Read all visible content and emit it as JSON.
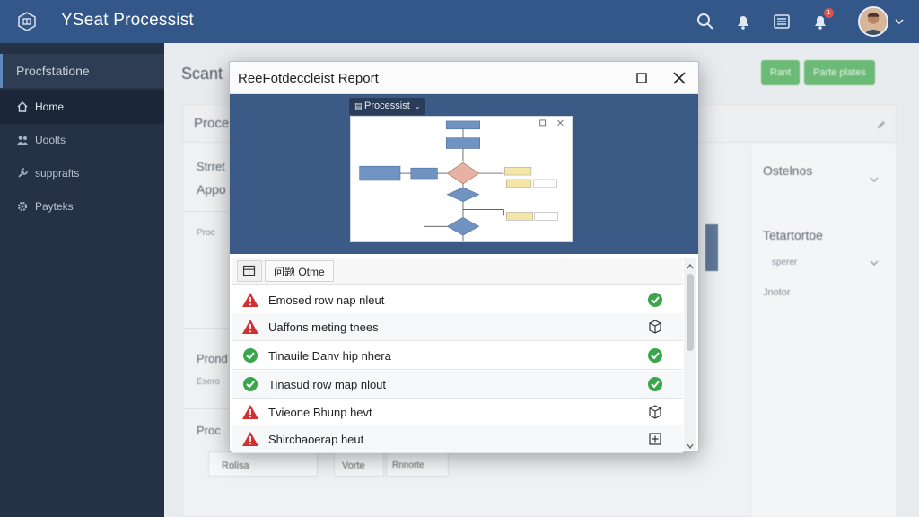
{
  "app": {
    "title": "YSeat Processist",
    "notification_count": "1"
  },
  "sidebar": {
    "header": "Procfstatione",
    "items": [
      {
        "label": "Home",
        "icon": "home-icon"
      },
      {
        "label": "Uoolts",
        "icon": "users-icon"
      },
      {
        "label": "supprafts",
        "icon": "tools-icon"
      },
      {
        "label": "Payteks",
        "icon": "gear-icon"
      }
    ]
  },
  "page": {
    "title": "Scant",
    "btn1": "Rant",
    "btn2": "Parte plates",
    "panel_title": "Proce",
    "left_labels": [
      "Strret",
      "Appo",
      "Proc",
      "Prond",
      "Esero",
      "Proc"
    ],
    "bottom_buttons": [
      "Rolisa",
      "Vorte",
      "Rnnorte"
    ],
    "right": {
      "label1": "Ostelnos",
      "label2": "Tetartortoe",
      "item1": "sperer",
      "item2": "Jnotor"
    }
  },
  "modal": {
    "title": "ReeFotdeccleist Report",
    "preview_tab": "Processist",
    "toolbar_label": "问题 Otme",
    "rows": [
      {
        "text": "Emosed row nap nleut",
        "status": "warning",
        "action": "check"
      },
      {
        "text": "Uaffons meting tnees",
        "status": "warning",
        "action": "cube"
      },
      {
        "text": "Tinauile Danv hip nhera",
        "status": "ok",
        "action": "check"
      },
      {
        "text": "Tinasud row map nlout",
        "status": "ok",
        "action": "check"
      },
      {
        "text": "Tvieone Bhunp hevt",
        "status": "warning",
        "action": "cube"
      },
      {
        "text": "Shirchaoerap heut",
        "status": "warning",
        "action": "plus"
      }
    ]
  },
  "colors": {
    "topbar": "#34578a",
    "sidebar": "#253245",
    "accent_green": "#4caf5a",
    "warning_red": "#d9534f",
    "ok_green": "#3aa54a"
  }
}
